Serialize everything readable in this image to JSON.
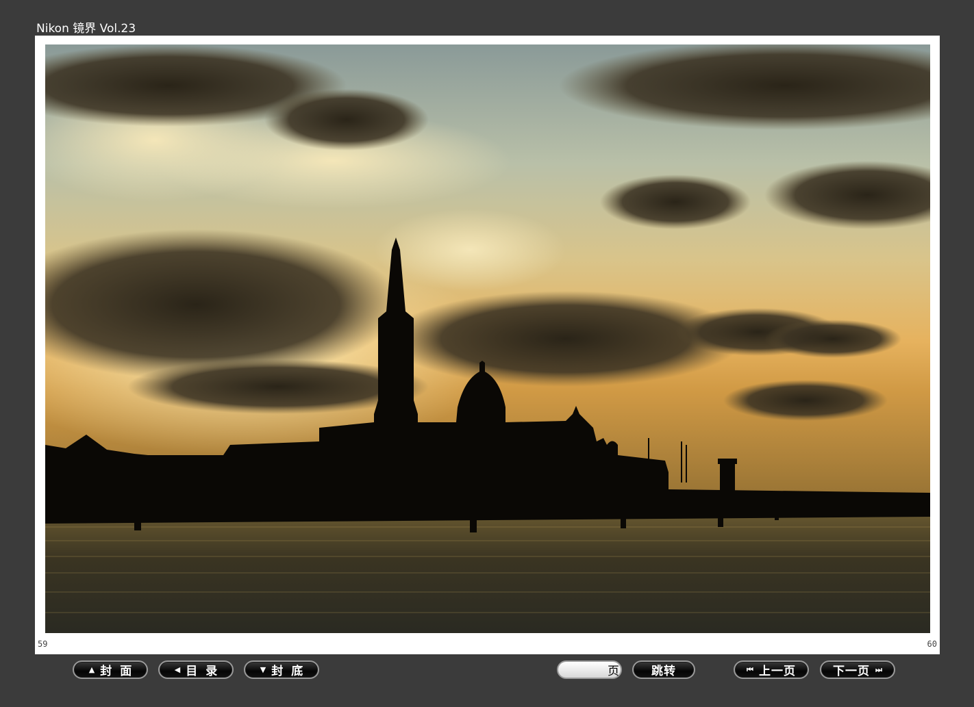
{
  "app": {
    "title": "Nikon 镜界 Vol.23"
  },
  "page": {
    "left_number": "59",
    "right_number": "60"
  },
  "photo": {
    "subject": "sunset-silhouette"
  },
  "nav": {
    "cover": {
      "label": "封面",
      "icon": "triangle-up-icon"
    },
    "contents": {
      "label": "目录",
      "icon": "triangle-left-icon"
    },
    "back_cover": {
      "label": "封底",
      "icon": "triangle-down-icon"
    },
    "page_input": {
      "value": "",
      "unit": "页"
    },
    "jump": {
      "label": "跳转"
    },
    "prev": {
      "label": "上一页",
      "icon": "skip-back-icon"
    },
    "next": {
      "label": "下一页",
      "icon": "skip-forward-icon"
    }
  },
  "colors": {
    "background": "#3b3b3b",
    "frame": "#ffffff",
    "button": "#0a0a0a"
  }
}
